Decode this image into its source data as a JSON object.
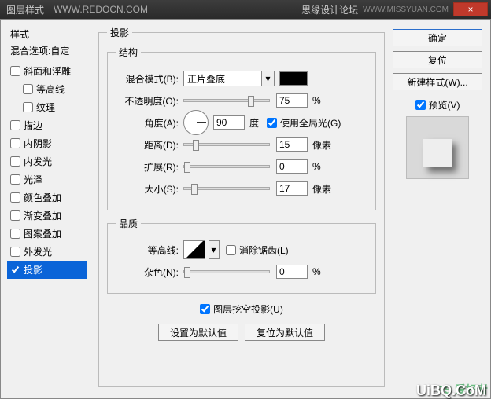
{
  "titlebar": {
    "title": "图层样式",
    "url": "WWW.REDOCN.COM",
    "forum": "思缘设计论坛",
    "forum_url": "WWW.MISSYUAN.COM",
    "close": "×"
  },
  "sidebar": {
    "header": "样式",
    "sub": "混合选项:自定",
    "items": [
      {
        "label": "斜面和浮雕",
        "checked": false,
        "indent": false
      },
      {
        "label": "等高线",
        "checked": false,
        "indent": true
      },
      {
        "label": "纹理",
        "checked": false,
        "indent": true
      },
      {
        "label": "描边",
        "checked": false,
        "indent": false
      },
      {
        "label": "内阴影",
        "checked": false,
        "indent": false
      },
      {
        "label": "内发光",
        "checked": false,
        "indent": false
      },
      {
        "label": "光泽",
        "checked": false,
        "indent": false
      },
      {
        "label": "颜色叠加",
        "checked": false,
        "indent": false
      },
      {
        "label": "渐变叠加",
        "checked": false,
        "indent": false
      },
      {
        "label": "图案叠加",
        "checked": false,
        "indent": false
      },
      {
        "label": "外发光",
        "checked": false,
        "indent": false
      },
      {
        "label": "投影",
        "checked": true,
        "indent": false,
        "selected": true
      }
    ]
  },
  "panel": {
    "title": "投影",
    "structure": {
      "legend": "结构",
      "blend_label": "混合模式(B):",
      "blend_value": "正片叠底",
      "color": "#000000",
      "opacity_label": "不透明度(O):",
      "opacity_value": "75",
      "opacity_unit": "%",
      "angle_label": "角度(A):",
      "angle_value": "90",
      "angle_unit": "度",
      "global_light_label": "使用全局光(G)",
      "global_light_checked": true,
      "distance_label": "距离(D):",
      "distance_value": "15",
      "distance_unit": "像素",
      "spread_label": "扩展(R):",
      "spread_value": "0",
      "spread_unit": "%",
      "size_label": "大小(S):",
      "size_value": "17",
      "size_unit": "像素"
    },
    "quality": {
      "legend": "品质",
      "contour_label": "等高线:",
      "antialias_label": "消除锯齿(L)",
      "antialias_checked": false,
      "noise_label": "杂色(N):",
      "noise_value": "0",
      "noise_unit": "%"
    },
    "knockout": {
      "label": "图层挖空投影(U)",
      "checked": true
    },
    "defaults_set": "设置为默认值",
    "defaults_reset": "复位为默认值"
  },
  "rightcol": {
    "ok": "确定",
    "reset": "复位",
    "newstyle": "新建样式(W)...",
    "preview_label": "预览(V)",
    "preview_checked": true
  },
  "watermark": {
    "a": "PS 爱好者",
    "b": "UiBQ.CoM"
  }
}
